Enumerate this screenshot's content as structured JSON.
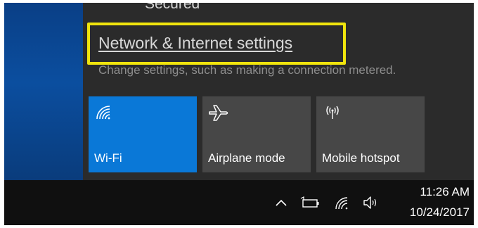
{
  "flyout": {
    "status": "Secured",
    "settings_link": "Network & Internet settings",
    "settings_description": "Change settings, such as making a connection metered.",
    "highlight_color": "#f0e40d"
  },
  "quick_actions": [
    {
      "label": "Wi-Fi",
      "icon": "wifi-icon",
      "active": true
    },
    {
      "label": "Airplane mode",
      "icon": "airplane-icon",
      "active": false
    },
    {
      "label": "Mobile hotspot",
      "icon": "hotspot-icon",
      "active": false
    }
  ],
  "taskbar": {
    "tray_icons": [
      "chevron-up-icon",
      "battery-icon",
      "wifi-icon",
      "volume-icon"
    ],
    "time": "11:26 AM",
    "date": "10/24/2017"
  },
  "colors": {
    "active_tile": "#0a78d7",
    "inactive_tile": "#474747",
    "flyout_background": "#2b2b2b",
    "taskbar_background": "#101010"
  }
}
